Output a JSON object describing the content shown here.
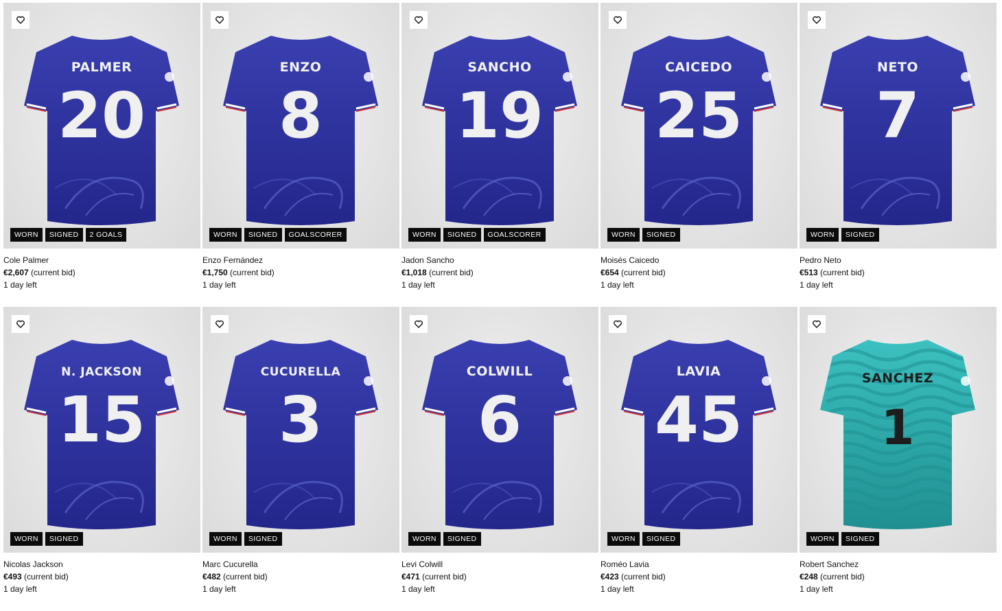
{
  "bid_suffix": "(current bid)",
  "items": [
    {
      "name": "Cole Palmer",
      "price": "€2,607",
      "time_left": "1 day left",
      "shirt_name": "PALMER",
      "shirt_number": "20",
      "kit": "home",
      "tags": [
        "WORN",
        "SIGNED",
        "2 GOALS"
      ]
    },
    {
      "name": "Enzo Fernández",
      "price": "€1,750",
      "time_left": "1 day left",
      "shirt_name": "ENZO",
      "shirt_number": "8",
      "kit": "home",
      "tags": [
        "WORN",
        "SIGNED",
        "GOALSCORER"
      ]
    },
    {
      "name": "Jadon Sancho",
      "price": "€1,018",
      "time_left": "1 day left",
      "shirt_name": "SANCHO",
      "shirt_number": "19",
      "kit": "home",
      "tags": [
        "WORN",
        "SIGNED",
        "GOALSCORER"
      ]
    },
    {
      "name": "Moisés Caicedo",
      "price": "€654",
      "time_left": "1 day left",
      "shirt_name": "CAICEDO",
      "shirt_number": "25",
      "kit": "home",
      "tags": [
        "WORN",
        "SIGNED"
      ]
    },
    {
      "name": "Pedro Neto",
      "price": "€513",
      "time_left": "1 day left",
      "shirt_name": "NETO",
      "shirt_number": "7",
      "kit": "home",
      "tags": [
        "WORN",
        "SIGNED"
      ]
    },
    {
      "name": "Nicolas Jackson",
      "price": "€493",
      "time_left": "1 day left",
      "shirt_name": "N. JACKSON",
      "shirt_number": "15",
      "kit": "home",
      "tags": [
        "WORN",
        "SIGNED"
      ]
    },
    {
      "name": "Marc Cucurella",
      "price": "€482",
      "time_left": "1 day left",
      "shirt_name": "CUCURELLA",
      "shirt_number": "3",
      "kit": "home",
      "tags": [
        "WORN",
        "SIGNED"
      ]
    },
    {
      "name": "Levi Colwill",
      "price": "€471",
      "time_left": "1 day left",
      "shirt_name": "COLWILL",
      "shirt_number": "6",
      "kit": "home",
      "tags": [
        "WORN",
        "SIGNED"
      ]
    },
    {
      "name": "Roméo Lavia",
      "price": "€423",
      "time_left": "1 day left",
      "shirt_name": "LAVIA",
      "shirt_number": "45",
      "kit": "home",
      "tags": [
        "WORN",
        "SIGNED"
      ]
    },
    {
      "name": "Robert Sanchez",
      "price": "€248",
      "time_left": "1 day left",
      "shirt_name": "SANCHEZ",
      "shirt_number": "1",
      "kit": "goalkeeper",
      "tags": [
        "WORN",
        "SIGNED"
      ]
    }
  ],
  "colors": {
    "home_kit": "#3a3fb0",
    "home_kit_dark": "#23268a",
    "goalkeeper_kit": "#3cc1c0",
    "goalkeeper_kit_dark": "#1f8f92",
    "tag_background": "#0b0b0b"
  },
  "icons": {
    "favorite": "heart-outline-icon"
  }
}
